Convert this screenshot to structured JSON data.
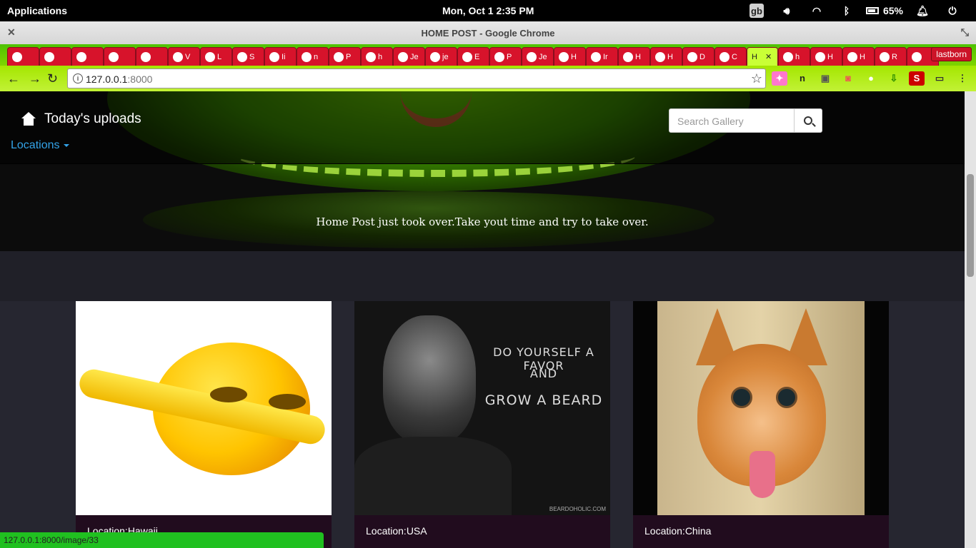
{
  "os_bar": {
    "applications": "Applications",
    "clock": "Mon, Oct  1   2:35 PM",
    "keyboard": "gb",
    "battery": "65%"
  },
  "window": {
    "title": "HOME POST - Google Chrome"
  },
  "tabs": [
    {
      "label": ""
    },
    {
      "label": ""
    },
    {
      "label": ""
    },
    {
      "label": ""
    },
    {
      "label": ""
    },
    {
      "label": "V"
    },
    {
      "label": "L"
    },
    {
      "label": "S"
    },
    {
      "label": "Ii"
    },
    {
      "label": "n"
    },
    {
      "label": "P"
    },
    {
      "label": "h"
    },
    {
      "label": "Je"
    },
    {
      "label": "je"
    },
    {
      "label": "E"
    },
    {
      "label": "P"
    },
    {
      "label": "Je"
    },
    {
      "label": "H"
    },
    {
      "label": "Ir"
    },
    {
      "label": "H"
    },
    {
      "label": "H"
    },
    {
      "label": "D"
    },
    {
      "label": "C"
    },
    {
      "label": "H",
      "active": true
    },
    {
      "label": "h"
    },
    {
      "label": "H"
    },
    {
      "label": "H"
    },
    {
      "label": "R"
    },
    {
      "label": ""
    }
  ],
  "profile": "lastborn",
  "address_bar": {
    "host": "127.0.0.1",
    "port": ":8000"
  },
  "navbar": {
    "brand": "Today's uploads",
    "locations": "Locations",
    "search_placeholder": "Search Gallery"
  },
  "hero": {
    "tagline": "Home Post just took over.Take yout time and try to take over."
  },
  "images": [
    {
      "location": "Location:Hawaii"
    },
    {
      "location": "Location:USA",
      "overlay": [
        "DO YOURSELF A FAVOR",
        "AND",
        "GROW A BEARD"
      ],
      "credit": "BEARDOHOLIC.COM"
    },
    {
      "location": "Location:China"
    }
  ],
  "status_url": "127.0.0.1:8000/image/33",
  "colors": {
    "tab_strip": "#4ec200",
    "toolbar": "#a4e600",
    "tab": "#d7132b",
    "link": "#33a3e8",
    "card_caption": "#210c1e",
    "status_bar": "#20c020"
  }
}
